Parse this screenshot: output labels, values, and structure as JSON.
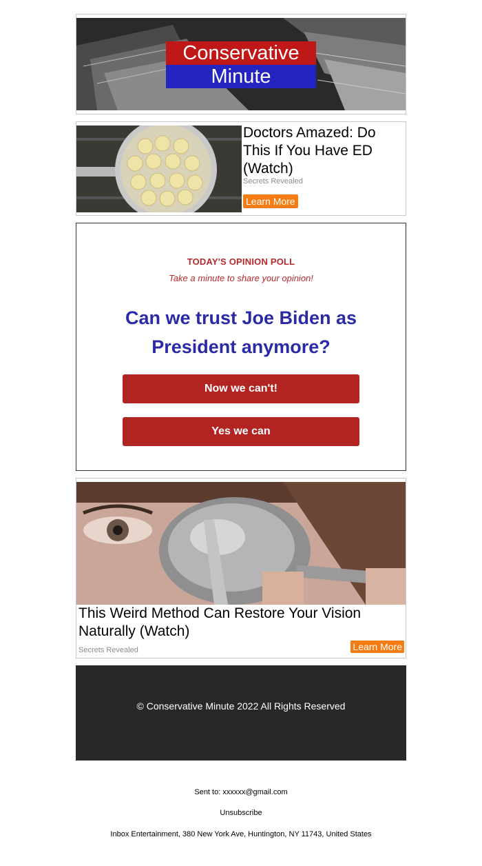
{
  "header": {
    "logo_line1": "Conservative",
    "logo_line2": "Minute",
    "colors": {
      "logo_red": "#c01717",
      "logo_blue": "#2424c0"
    }
  },
  "ad1": {
    "title": "Doctors Amazed: Do This If You Have ED (Watch)",
    "source": "Secrets Revealed",
    "button": "Learn More"
  },
  "poll": {
    "kicker": "TODAY'S OPINION POLL",
    "subtitle": "Take a minute to share your opinion!",
    "question": "Can we trust Joe Biden as President anymore?",
    "options": [
      "Now we can't!",
      "Yes we can"
    ],
    "colors": {
      "accent": "#b12421",
      "question": "#2a2aa6"
    }
  },
  "ad2": {
    "title": "This Weird Method Can Restore Your Vision Naturally (Watch)",
    "source": "Secrets Revealed",
    "button": "Learn More"
  },
  "footer": {
    "copyright": "© Conservative Minute 2022 All Rights Reserved",
    "sent_to": "Sent to: xxxxxx@gmail.com",
    "unsubscribe": "Unsubscribe",
    "address": "Inbox Entertainment, 380 New York Ave, Huntington, NY 11743, United States"
  }
}
